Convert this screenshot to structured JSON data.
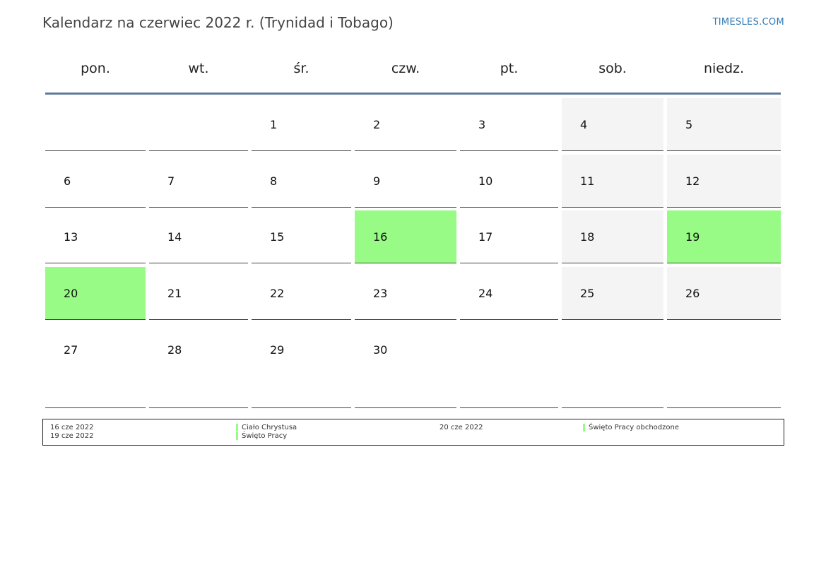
{
  "header": {
    "title": "Kalendarz na czerwiec 2022 r. (Trynidad i Tobago)",
    "site": "TIMESLES.COM"
  },
  "colors": {
    "holiday": "#98fb86",
    "weekend": "#f4f4f4",
    "rule": "#5e7a9b",
    "link": "#2e79b5"
  },
  "weekdays": [
    "pon.",
    "wt.",
    "śr.",
    "czw.",
    "pt.",
    "sob.",
    "niedz."
  ],
  "weeks": [
    [
      {
        "day": "",
        "type": "normal"
      },
      {
        "day": "",
        "type": "normal"
      },
      {
        "day": "1",
        "type": "normal"
      },
      {
        "day": "2",
        "type": "normal"
      },
      {
        "day": "3",
        "type": "normal"
      },
      {
        "day": "4",
        "type": "weekend"
      },
      {
        "day": "5",
        "type": "weekend"
      }
    ],
    [
      {
        "day": "6",
        "type": "normal"
      },
      {
        "day": "7",
        "type": "normal"
      },
      {
        "day": "8",
        "type": "normal"
      },
      {
        "day": "9",
        "type": "normal"
      },
      {
        "day": "10",
        "type": "normal"
      },
      {
        "day": "11",
        "type": "weekend"
      },
      {
        "day": "12",
        "type": "weekend"
      }
    ],
    [
      {
        "day": "13",
        "type": "normal"
      },
      {
        "day": "14",
        "type": "normal"
      },
      {
        "day": "15",
        "type": "normal"
      },
      {
        "day": "16",
        "type": "holiday"
      },
      {
        "day": "17",
        "type": "normal"
      },
      {
        "day": "18",
        "type": "weekend"
      },
      {
        "day": "19",
        "type": "holiday"
      }
    ],
    [
      {
        "day": "20",
        "type": "holiday"
      },
      {
        "day": "21",
        "type": "normal"
      },
      {
        "day": "22",
        "type": "normal"
      },
      {
        "day": "23",
        "type": "normal"
      },
      {
        "day": "24",
        "type": "normal"
      },
      {
        "day": "25",
        "type": "weekend"
      },
      {
        "day": "26",
        "type": "weekend"
      }
    ],
    [
      {
        "day": "27",
        "type": "normal"
      },
      {
        "day": "28",
        "type": "normal"
      },
      {
        "day": "29",
        "type": "normal"
      },
      {
        "day": "30",
        "type": "normal"
      },
      {
        "day": "",
        "type": "normal"
      },
      {
        "day": "",
        "type": "normal"
      },
      {
        "day": "",
        "type": "normal"
      }
    ]
  ],
  "holidays": [
    {
      "date": "16 cze 2022",
      "name": "Ciało Chrystusa"
    },
    {
      "date": "19 cze 2022",
      "name": "Święto Pracy"
    },
    {
      "date": "20 cze 2022",
      "name": "Święto Pracy obchodzone"
    }
  ]
}
